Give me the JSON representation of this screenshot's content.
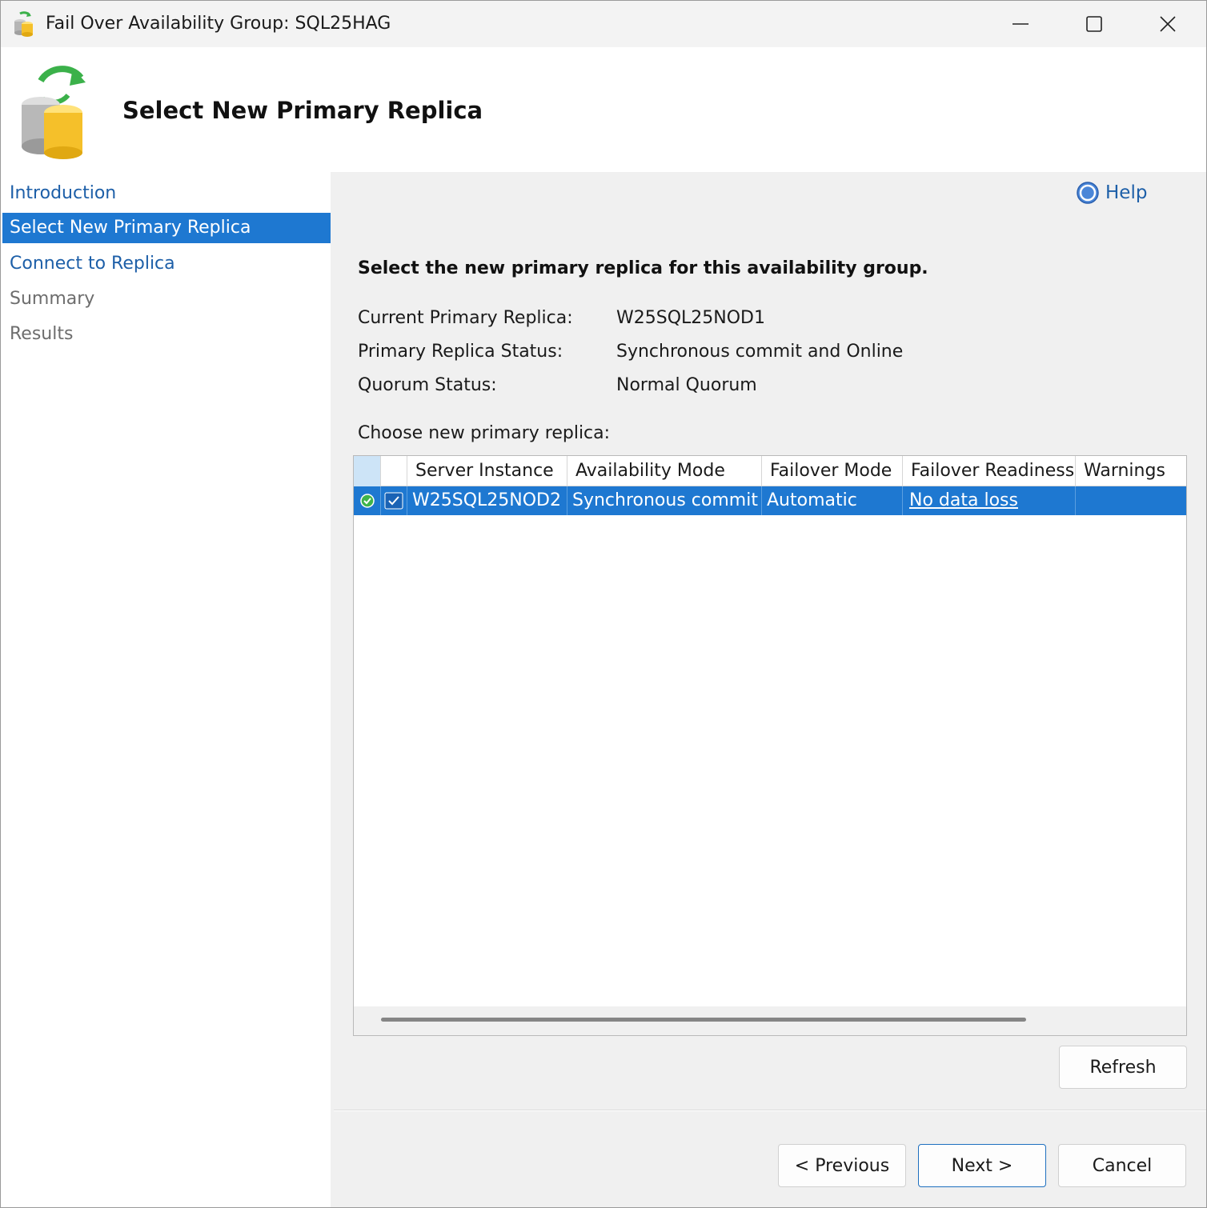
{
  "window": {
    "title": "Fail Over Availability Group: SQL25HAG",
    "minimize_label": "Minimize",
    "maximize_label": "Maximize",
    "close_label": "Close"
  },
  "banner": {
    "title": "Select New Primary Replica"
  },
  "nav": {
    "items": [
      {
        "label": "Introduction",
        "state": "link"
      },
      {
        "label": "Select New Primary Replica",
        "state": "active"
      },
      {
        "label": "Connect to Replica",
        "state": "link"
      },
      {
        "label": "Summary",
        "state": "disabled"
      },
      {
        "label": "Results",
        "state": "disabled"
      }
    ]
  },
  "main": {
    "help_label": "Help",
    "instruction": "Select the new primary replica for this availability group.",
    "info": [
      {
        "label": "Current Primary Replica:",
        "value": "W25SQL25NOD1"
      },
      {
        "label": "Primary Replica Status:",
        "value": "Synchronous commit and Online"
      },
      {
        "label": "Quorum Status:",
        "value": "Normal Quorum"
      }
    ],
    "choose_label": "Choose new primary replica:"
  },
  "grid": {
    "columns": [
      "Server Instance",
      "Availability Mode",
      "Failover Mode",
      "Failover Readiness",
      "Warnings"
    ],
    "rows": [
      {
        "server_instance": "W25SQL25NOD2",
        "availability_mode": "Synchronous commit",
        "failover_mode": "Automatic",
        "failover_readiness": "No data loss",
        "warnings": "",
        "selected": true
      }
    ]
  },
  "buttons": {
    "refresh": "Refresh",
    "previous": "< Previous",
    "next": "Next >",
    "cancel": "Cancel"
  },
  "colors": {
    "accent": "#1e78d1",
    "link": "#1d5fa8"
  }
}
